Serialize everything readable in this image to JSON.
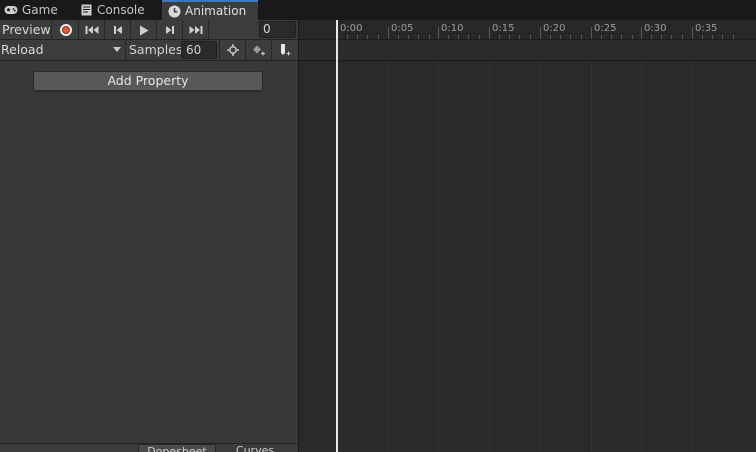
{
  "tabs": [
    {
      "label": "Game",
      "icon": "gamepad-icon",
      "active": false
    },
    {
      "label": "Console",
      "icon": "console-icon",
      "active": false
    },
    {
      "label": "Animation",
      "icon": "clock-icon",
      "active": true
    }
  ],
  "toolbar": {
    "preview_label": "Preview",
    "frame_value": "0",
    "clip_name": "Reload",
    "samples_label": "Samples",
    "samples_value": "60"
  },
  "add_property_label": "Add Property",
  "bottom_tabs": [
    {
      "label": "Dopesheet"
    },
    {
      "label": "Curves"
    }
  ],
  "timeline": {
    "ticks": [
      "0:00",
      "0:05",
      "0:10",
      "0:15",
      "0:20",
      "0:25",
      "0:30",
      "0:35"
    ]
  },
  "colors": {
    "record": "#e5573c",
    "active_tab_accent": "#3a79bb",
    "playhead": "#e8e8e8"
  }
}
